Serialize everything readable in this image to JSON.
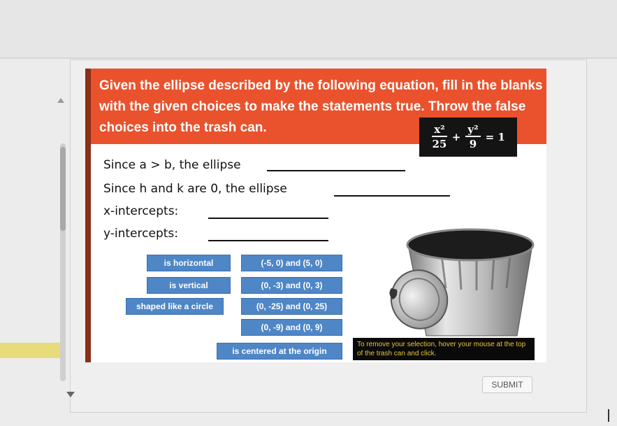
{
  "instructions": "Given the ellipse described by the following equation, fill in the blanks with the given choices to make the statements true. Throw the false choices into the trash can.",
  "equation": {
    "term1_num": "x²",
    "term1_den": "25",
    "plus": "+",
    "term2_num": "y²",
    "term2_den": "9",
    "rhs": "= 1"
  },
  "statements": [
    "Since a > b, the ellipse",
    "Since h and k are 0, the ellipse",
    "x-intercepts:",
    "y-intercepts:"
  ],
  "choices": {
    "is_horizontal": "is horizontal",
    "is_vertical": "is vertical",
    "shaped_like_circle": "shaped like a circle",
    "is_centered": "is centered at the origin",
    "c1": "(-5, 0) and (5, 0)",
    "c2": "(0, -3) and (0, 3)",
    "c3": "(0, -25) and (0, 25)",
    "c4": "(0, -9) and (0, 9)"
  },
  "tooltip": "To remove your selection, hover your mouse at the top of the trash can and click.",
  "submit_label": "SUBMIT",
  "colors": {
    "header_bg": "#e9522d",
    "choice_bg": "#4f86c6",
    "tooltip_text": "#e8c53a"
  }
}
